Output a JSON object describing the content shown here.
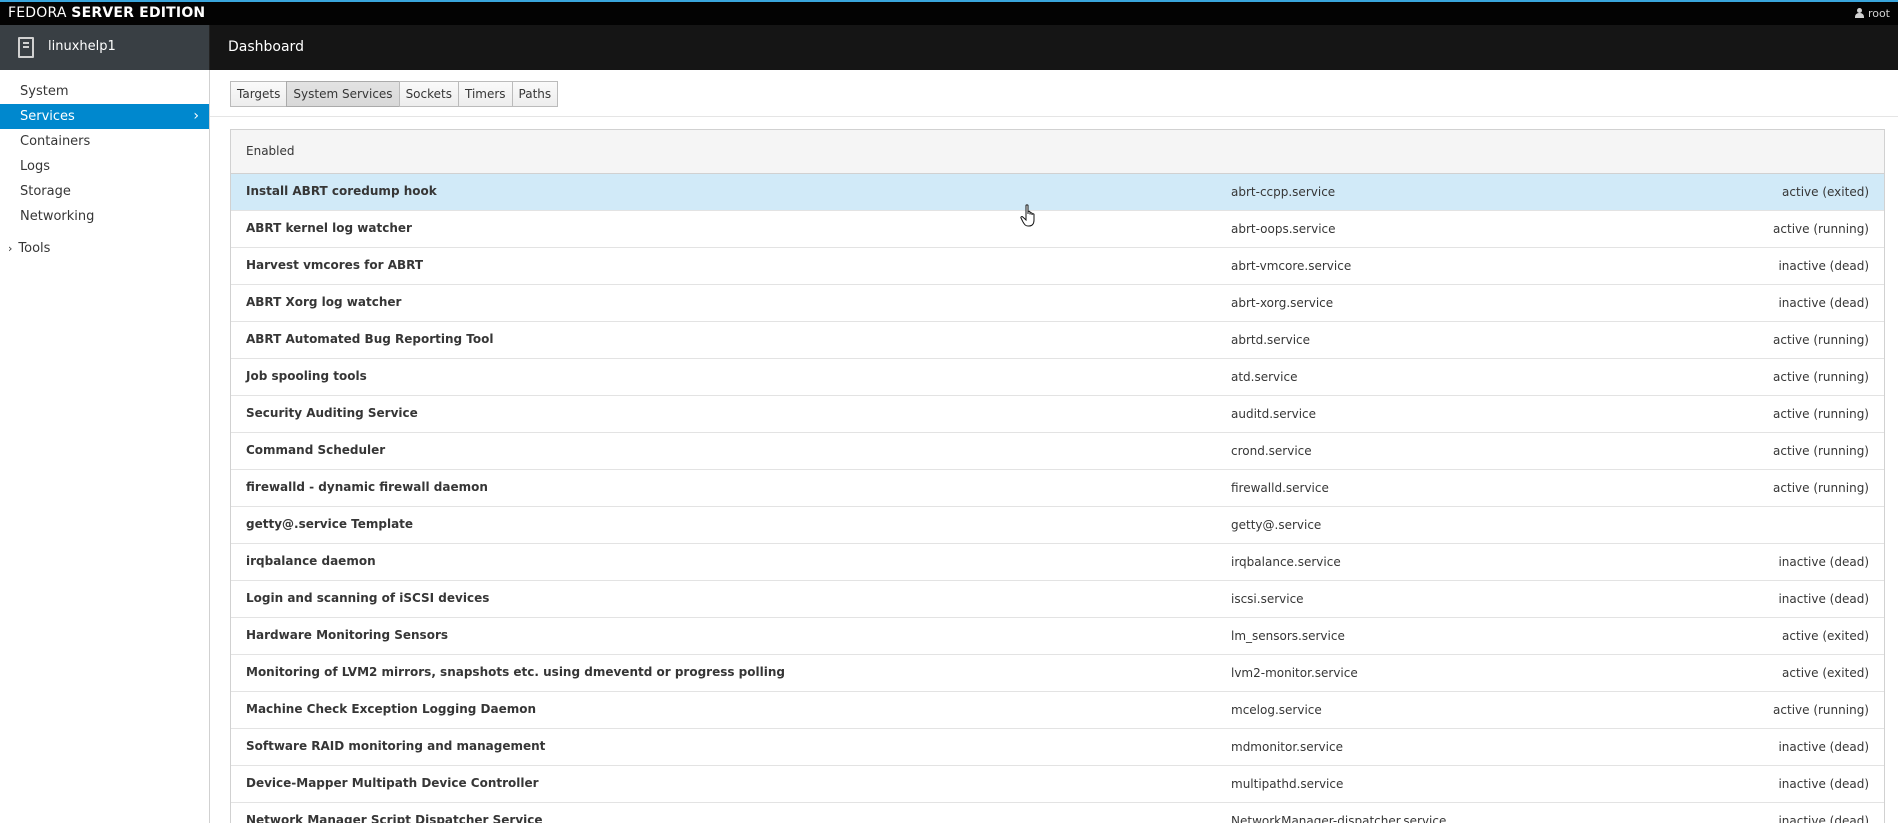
{
  "topbar": {
    "brand_part1": "FEDORA",
    "brand_part2": "SERVER EDITION",
    "user_icon": "user-icon",
    "user": "root"
  },
  "header": {
    "host_icon": "server-icon",
    "host": "linuxhelp1",
    "breadcrumb": "Dashboard"
  },
  "sidebar": {
    "items": [
      {
        "label": "System"
      },
      {
        "label": "Services"
      },
      {
        "label": "Containers"
      },
      {
        "label": "Logs"
      },
      {
        "label": "Storage"
      },
      {
        "label": "Networking"
      }
    ],
    "active_chevron": "›",
    "tools": {
      "label": "Tools",
      "chevron": "›"
    }
  },
  "tabs": [
    {
      "label": "Targets"
    },
    {
      "label": "System Services"
    },
    {
      "label": "Sockets"
    },
    {
      "label": "Timers"
    },
    {
      "label": "Paths"
    }
  ],
  "panel": {
    "heading": "Enabled",
    "rows": [
      {
        "description": "Install ABRT coredump hook",
        "unit": "abrt-ccpp.service",
        "state": "active (exited)"
      },
      {
        "description": "ABRT kernel log watcher",
        "unit": "abrt-oops.service",
        "state": "active (running)"
      },
      {
        "description": "Harvest vmcores for ABRT",
        "unit": "abrt-vmcore.service",
        "state": "inactive (dead)"
      },
      {
        "description": "ABRT Xorg log watcher",
        "unit": "abrt-xorg.service",
        "state": "inactive (dead)"
      },
      {
        "description": "ABRT Automated Bug Reporting Tool",
        "unit": "abrtd.service",
        "state": "active (running)"
      },
      {
        "description": "Job spooling tools",
        "unit": "atd.service",
        "state": "active (running)"
      },
      {
        "description": "Security Auditing Service",
        "unit": "auditd.service",
        "state": "active (running)"
      },
      {
        "description": "Command Scheduler",
        "unit": "crond.service",
        "state": "active (running)"
      },
      {
        "description": "firewalld - dynamic firewall daemon",
        "unit": "firewalld.service",
        "state": "active (running)"
      },
      {
        "description": "getty@.service Template",
        "unit": "getty@.service",
        "state": ""
      },
      {
        "description": "irqbalance daemon",
        "unit": "irqbalance.service",
        "state": "inactive (dead)"
      },
      {
        "description": "Login and scanning of iSCSI devices",
        "unit": "iscsi.service",
        "state": "inactive (dead)"
      },
      {
        "description": "Hardware Monitoring Sensors",
        "unit": "lm_sensors.service",
        "state": "active (exited)"
      },
      {
        "description": "Monitoring of LVM2 mirrors, snapshots etc. using dmeventd or progress polling",
        "unit": "lvm2-monitor.service",
        "state": "active (exited)"
      },
      {
        "description": "Machine Check Exception Logging Daemon",
        "unit": "mcelog.service",
        "state": "active (running)"
      },
      {
        "description": "Software RAID monitoring and management",
        "unit": "mdmonitor.service",
        "state": "inactive (dead)"
      },
      {
        "description": "Device-Mapper Multipath Device Controller",
        "unit": "multipathd.service",
        "state": "inactive (dead)"
      },
      {
        "description": "Network Manager Script Dispatcher Service",
        "unit": "NetworkManager-dispatcher.service",
        "state": "inactive (dead)"
      }
    ]
  },
  "colors": {
    "accent": "#0088ce",
    "topbar_border": "#39a5dc",
    "row_highlight": "#d1eaf8",
    "header_bg": "#151515"
  }
}
